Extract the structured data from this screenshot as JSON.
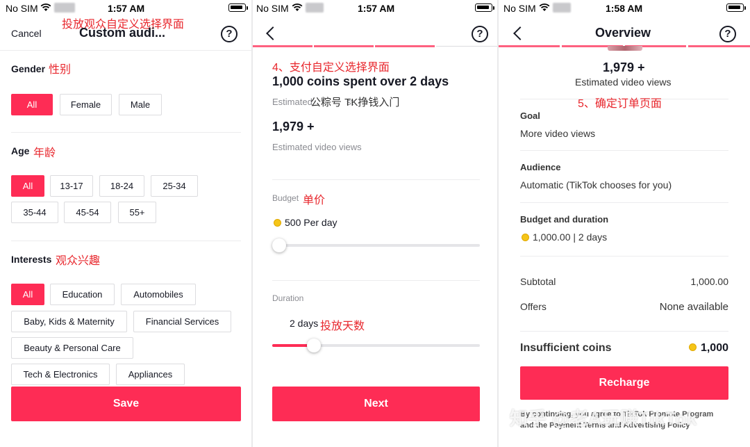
{
  "colors": {
    "accent": "#fe2c55",
    "annotation": "#e8272d",
    "coin": "#f5c518"
  },
  "status": {
    "p1": {
      "carrier": "No SIM",
      "time": "1:57 AM"
    },
    "p2": {
      "carrier": "No SIM",
      "time": "1:57 AM"
    },
    "p3": {
      "carrier": "No SIM",
      "time": "1:58 AM"
    }
  },
  "panel1": {
    "annotation": "投放观众自定义选择界面",
    "cancel": "Cancel",
    "title": "Custom audi...",
    "help": "?",
    "gender": {
      "label": "Gender",
      "note": "性别",
      "options": [
        "All",
        "Female",
        "Male"
      ]
    },
    "age": {
      "label": "Age",
      "note": "年龄",
      "options": [
        "All",
        "13-17",
        "18-24",
        "25-34",
        "35-44",
        "45-54",
        "55+"
      ]
    },
    "interests": {
      "label": "Interests",
      "note": "观众兴趣",
      "options": [
        "All",
        "Education",
        "Automobiles",
        "Baby, Kids & Maternity",
        "Financial Services",
        "Beauty & Personal Care",
        "Tech & Electronics",
        "Appliances"
      ]
    },
    "save": "Save"
  },
  "panel2": {
    "help": "?",
    "annotation": "4、支付自定义选择界面",
    "headline": "1,000 coins spent over 2 days",
    "estimated_partial": "Estimated",
    "estimated_tail": "st",
    "overlay_text": "公粽号  TK挣钱入门",
    "views": "1,979 +",
    "views_label": "Estimated video views",
    "budget": {
      "label": "Budget",
      "note": "单价",
      "value": "500 Per day",
      "position": 0.0
    },
    "duration": {
      "label": "Duration",
      "value": "2 days",
      "note": "投放天数",
      "position": 0.18
    },
    "next": "Next"
  },
  "panel3": {
    "title": "Overview",
    "help": "?",
    "views": "1,979 +",
    "views_label": "Estimated video views",
    "annotation": "5、确定订单页面",
    "goal": {
      "label": "Goal",
      "value": "More video views"
    },
    "audience": {
      "label": "Audience",
      "value": "Automatic (TikTok chooses for you)"
    },
    "budget_duration": {
      "label": "Budget and duration",
      "value": "1,000.00 | 2 days"
    },
    "subtotal": {
      "label": "Subtotal",
      "value": "1,000.00"
    },
    "offers": {
      "label": "Offers",
      "value": "None available"
    },
    "insufficient": {
      "label": "Insufficient coins",
      "value": "1,000"
    },
    "recharge": "Recharge",
    "terms_line1": "By continuing, you agree to TikTok Promote Program",
    "terms_line2": "and the Payment Terms and Advertising Policy",
    "watermark": "知乎 @老A玩赚TikTok"
  }
}
